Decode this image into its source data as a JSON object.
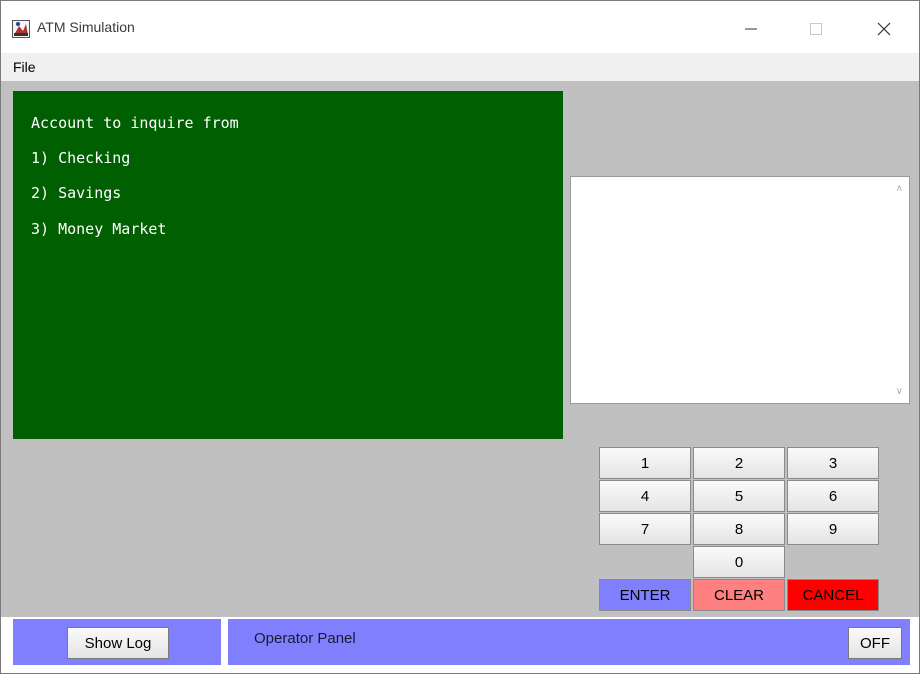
{
  "window": {
    "title": "ATM Simulation",
    "icon": "atm-app-icon"
  },
  "menu": {
    "items": [
      {
        "label": "File"
      }
    ]
  },
  "display": {
    "lines": [
      "Account to inquire from",
      "1) Checking",
      "2) Savings",
      "3) Money Market"
    ],
    "background": "#005f00",
    "text_color": "#ffffff"
  },
  "log": {
    "content": ""
  },
  "keypad": {
    "keys": [
      {
        "label": "1"
      },
      {
        "label": "2"
      },
      {
        "label": "3"
      },
      {
        "label": "4"
      },
      {
        "label": "5"
      },
      {
        "label": "6"
      },
      {
        "label": "7"
      },
      {
        "label": "8"
      },
      {
        "label": "9"
      },
      {
        "label": "0"
      }
    ],
    "enter": {
      "label": "ENTER",
      "color": "#8080ff"
    },
    "clear": {
      "label": "CLEAR",
      "color": "#ff8080"
    },
    "cancel": {
      "label": "CANCEL",
      "color": "#ff0000"
    }
  },
  "operator": {
    "show_log_label": "Show Log",
    "panel_label": "Operator Panel",
    "off_label": "OFF",
    "color": "#8080ff"
  }
}
